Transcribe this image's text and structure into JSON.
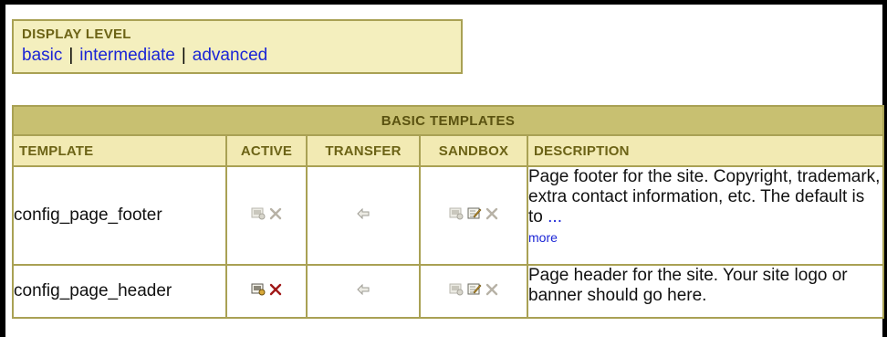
{
  "display_level": {
    "title": "DISPLAY LEVEL",
    "options": [
      "basic",
      "intermediate",
      "advanced"
    ],
    "separator": "|"
  },
  "table": {
    "caption": "BASIC TEMPLATES",
    "columns": [
      "TEMPLATE",
      "ACTIVE",
      "TRANSFER",
      "SANDBOX",
      "DESCRIPTION"
    ],
    "rows": [
      {
        "template": "config_page_footer",
        "description": "Page footer for the site. Copyright, trademark, extra contact information, etc. The default is to",
        "ellipsis": "...",
        "more_link": "more",
        "active_icons": [
          "view-icon-faded",
          "delete-icon-faded"
        ],
        "transfer_icon": "arrow-left-icon",
        "sandbox_icons": [
          "view-icon-faded",
          "edit-icon",
          "delete-icon-faded"
        ]
      },
      {
        "template": "config_page_header",
        "description": "Page header for the site. Your site logo or banner should go here.",
        "active_icons": [
          "view-icon",
          "delete-icon"
        ],
        "transfer_icon": "arrow-left-icon",
        "sandbox_icons": [
          "view-icon-faded",
          "edit-icon",
          "delete-icon-faded"
        ]
      }
    ]
  },
  "colors": {
    "panel_bg": "#f4efbe",
    "border": "#a9a154",
    "caption_bg": "#c8c071",
    "header_text": "#6c6316",
    "link": "#1b25d6",
    "delete_active": "#a01818",
    "delete_faded": "#b7b2a6"
  }
}
